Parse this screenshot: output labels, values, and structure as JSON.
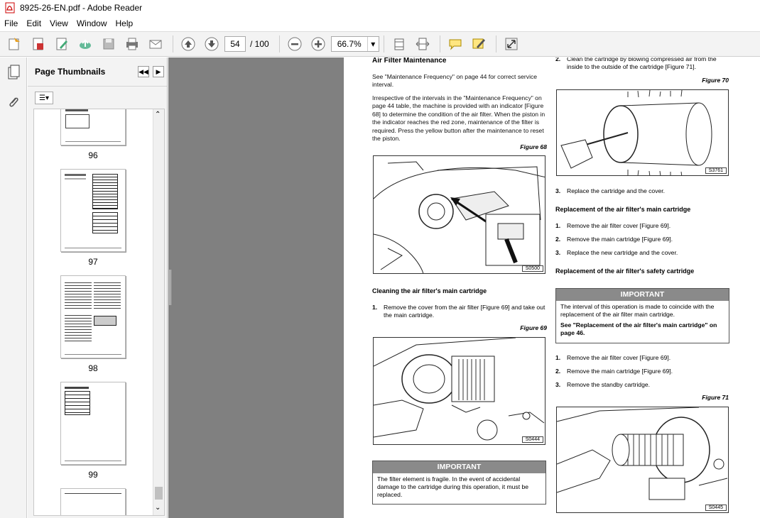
{
  "window": {
    "title": "8925-26-EN.pdf - Adobe Reader"
  },
  "menu": [
    "File",
    "Edit",
    "View",
    "Window",
    "Help"
  ],
  "toolbar": {
    "page_current": "54",
    "page_total": "/ 100",
    "zoom": "66.7%"
  },
  "thumbnails": {
    "title": "Page Thumbnails",
    "labels": [
      "96",
      "97",
      "98",
      "99"
    ]
  },
  "doc": {
    "air_filter_heading": "Air Filter Maintenance",
    "para1": "See \"Maintenance Frequency\" on page 44 for correct service interval.",
    "para2": "Irrespective of the intervals in the \"Maintenance Frequency\" on page 44 table, the machine is provided with an indicator [Figure 68] to determine the condition of the air filter. When the piston in the indicator reaches the red zone, maintenance of the filter is required. Press the yellow button after the maintenance to reset the piston.",
    "fig68": "Figure 68",
    "fig68_id": "S0500",
    "cleaning_heading": "Cleaning the air filter's main cartridge",
    "clean_step1_num": "1.",
    "clean_step1": "Remove the cover from the air filter [Figure 69] and take out the main cartridge.",
    "fig69": "Figure 69",
    "fig69_id": "S0444",
    "important1_title": "IMPORTANT",
    "important1_body": "The filter element is fragile. In the event of accidental damage to the cartridge during this operation, it must be replaced.",
    "step2_num": "2.",
    "step2": "Clean the cartridge by blowing compressed air from the inside to the outside of the cartridge [Figure 71].",
    "fig70": "Figure 70",
    "fig70_id": "S3761",
    "step3_num": "3.",
    "step3": "Replace the cartridge and the cover.",
    "replace_main_heading": "Replacement of the air filter's main cartridge",
    "replace_main_steps": [
      {
        "num": "1.",
        "text": "Remove the air filter cover [Figure 69]."
      },
      {
        "num": "2.",
        "text": "Remove the main cartridge [Figure 69]."
      },
      {
        "num": "3.",
        "text": "Replace the new cartridge and the cover."
      }
    ],
    "replace_safety_heading": "Replacement of the air filter's safety cartridge",
    "important2_title": "IMPORTANT",
    "important2_body": "The interval of this operation is made to coincide with the replacement of the air filter main cartridge.",
    "important2_ref": "See \"Replacement of the air filter's main cartridge\" on page 46.",
    "replace_safety_steps": [
      {
        "num": "1.",
        "text": "Remove the air filter cover [Figure 69]."
      },
      {
        "num": "2.",
        "text": "Remove the main cartridge [Figure 69]."
      },
      {
        "num": "3.",
        "text": "Remove the standby cartridge."
      }
    ],
    "fig71": "Figure 71",
    "fig71_id": "S0445"
  }
}
